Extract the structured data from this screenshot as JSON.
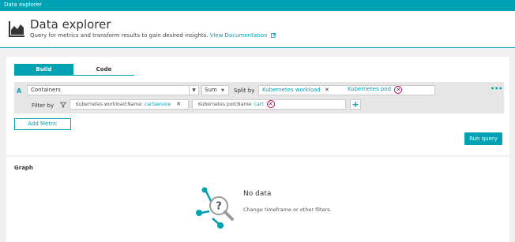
{
  "window": {
    "title": "Data explorer"
  },
  "header": {
    "title": "Data explorer",
    "subtitle": "Query for metrics and transform results to gain desired insights.",
    "doc_link": "View Documentation"
  },
  "tabs": [
    {
      "label": "Build",
      "active": true
    },
    {
      "label": "Code",
      "active": false
    }
  ],
  "query": {
    "letter": "A",
    "metric": "Containers",
    "aggregation": "Sum",
    "split_by_label": "Split by",
    "split_by": [
      "Kubernetes workload",
      "Kubernetes pod"
    ],
    "filter_label": "Filter by",
    "filters": [
      {
        "key": "Kubernetes workload:Name:",
        "value": "cartservice"
      },
      {
        "key": "Kubernetes pod:Name:",
        "value": "cart"
      }
    ],
    "more_label": "•••"
  },
  "buttons": {
    "add_metric": "Add Metric",
    "run_query": "Run query",
    "add_filter": "+"
  },
  "graph": {
    "title": "Graph",
    "empty_title": "No data",
    "empty_subtitle": "Change timeframe or other filters."
  },
  "colors": {
    "accent": "#00a1b2",
    "highlight": "#d4005e"
  }
}
